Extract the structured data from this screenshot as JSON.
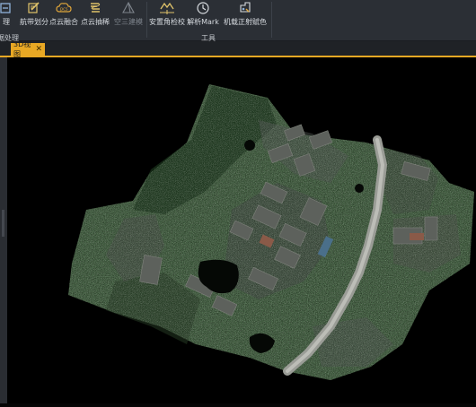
{
  "ribbon": {
    "tools": [
      {
        "id": "process",
        "label": "理",
        "icon": "process-icon",
        "enabled": true
      },
      {
        "id": "route-split",
        "label": "航带划分",
        "icon": "route-split-icon",
        "enabled": true
      },
      {
        "id": "pointcloud-fusion",
        "label": "点云融合",
        "icon": "pointcloud-fusion-icon",
        "enabled": true
      },
      {
        "id": "pointcloud-thinning",
        "label": "点云抽稀",
        "icon": "pointcloud-thinning-icon",
        "enabled": true
      },
      {
        "id": "build-3d",
        "label": "空三建模",
        "icon": "pyramid-icon",
        "enabled": false
      },
      {
        "id": "boresight",
        "label": "安置角检校",
        "icon": "boresight-icon",
        "enabled": true
      },
      {
        "id": "parse-mark",
        "label": "解析Mark",
        "icon": "clock-icon",
        "enabled": true
      },
      {
        "id": "airborne-coloring",
        "label": "机载正射赋色",
        "icon": "coloring-icon",
        "enabled": true
      }
    ],
    "groups": [
      {
        "id": "processing",
        "label": "据处理"
      },
      {
        "id": "tools",
        "label": "工具"
      }
    ]
  },
  "tabs": [
    {
      "label": "3D视图",
      "active": true,
      "close_icon": "close-icon"
    }
  ],
  "viewport": {
    "content": "3D point cloud rendering of urban area with elevated road",
    "background_color": "#000000",
    "accent_color": "#e8a824"
  }
}
